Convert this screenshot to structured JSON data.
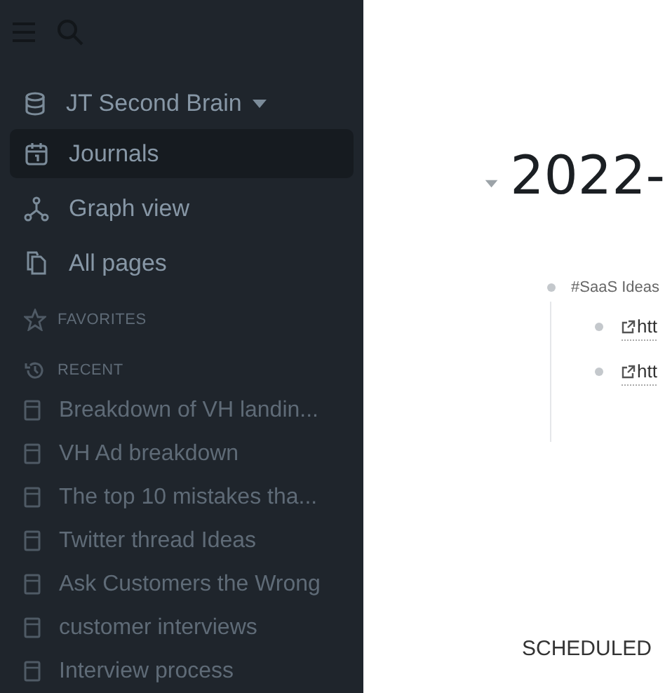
{
  "sidebar": {
    "graph": {
      "name": "JT Second Brain"
    },
    "nav": [
      {
        "label": "Journals",
        "selected": true
      },
      {
        "label": "Graph view",
        "selected": false
      },
      {
        "label": "All pages",
        "selected": false
      }
    ],
    "favorites": {
      "title": "FAVORITES"
    },
    "recent": {
      "title": "RECENT",
      "items": [
        {
          "label": "Breakdown of VH landin..."
        },
        {
          "label": "VH Ad breakdown"
        },
        {
          "label": "The top 10 mistakes tha..."
        },
        {
          "label": "Twitter thread Ideas"
        },
        {
          "label": "Ask Customers the Wrong"
        },
        {
          "label": "customer interviews"
        },
        {
          "label": "Interview process"
        }
      ]
    }
  },
  "journal": {
    "title": "2022-",
    "blocks": [
      {
        "text": "#SaaS Ideas",
        "children": [
          {
            "link": "htt"
          },
          {
            "link": "htt"
          }
        ]
      }
    ]
  },
  "scheduled": {
    "title": "SCHEDULED"
  }
}
